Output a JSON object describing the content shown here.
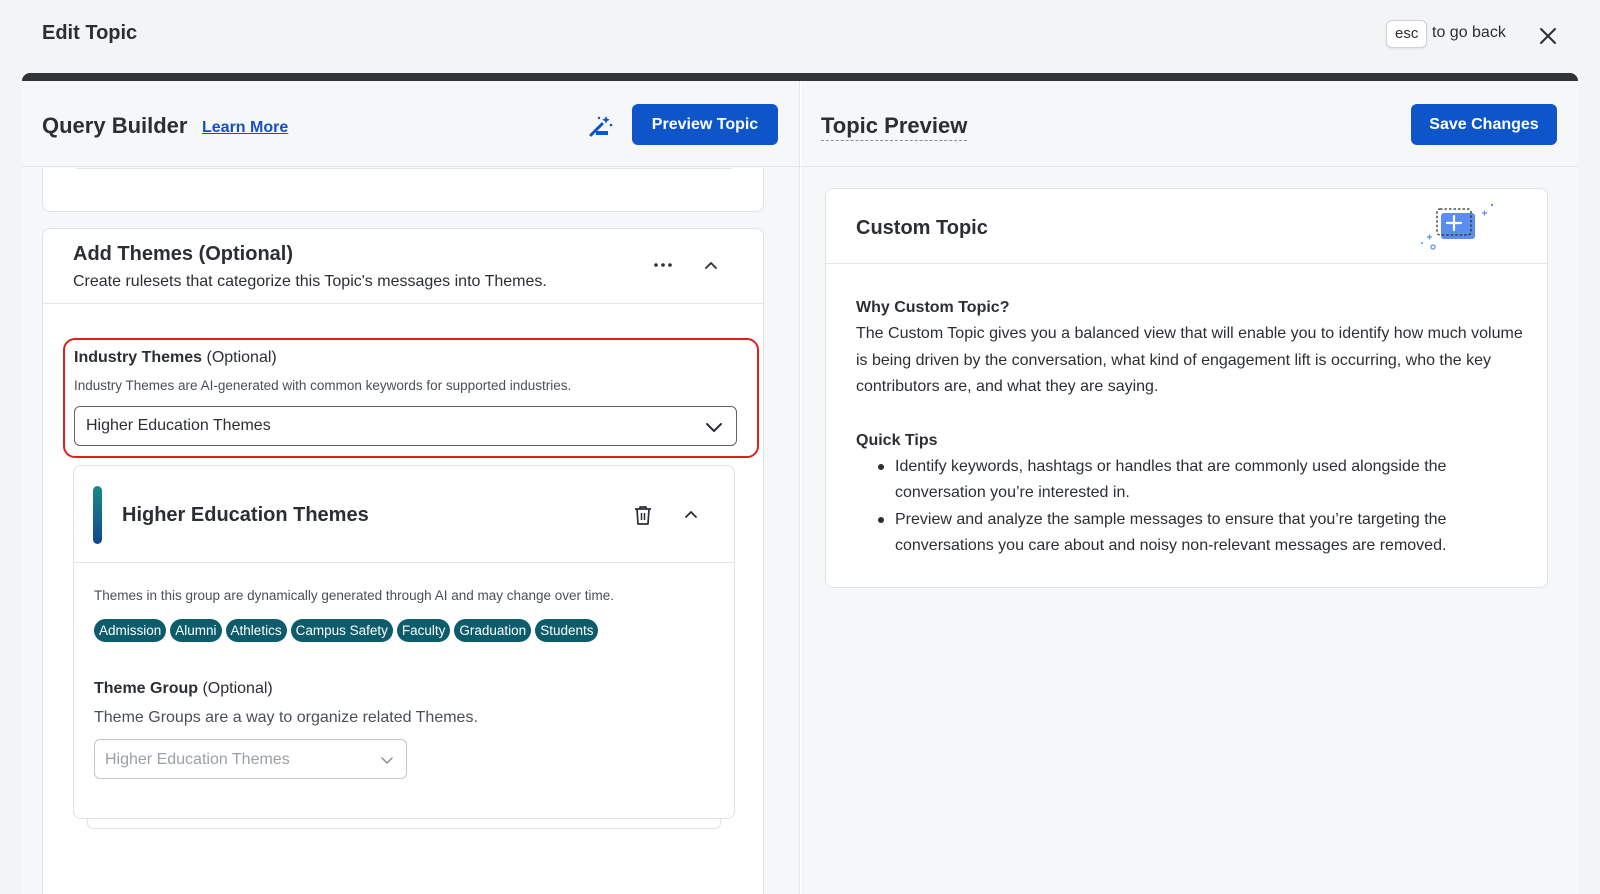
{
  "topbar": {
    "title": "Edit Topic",
    "esc_key": "esc",
    "esc_text": "to go back",
    "close_icon": "close-icon"
  },
  "query_builder": {
    "title": "Query Builder",
    "learn_more": "Learn More",
    "wand_icon": "magic-wand-icon",
    "preview_button": "Preview Topic",
    "themes": {
      "title": "Add Themes (Optional)",
      "subtitle": "Create rulesets that categorize this Topic's messages into Themes.",
      "industry": {
        "label": "Industry Themes",
        "optional": "(Optional)",
        "help": "Industry Themes are AI-generated with common keywords for supported industries.",
        "selected": "Higher Education Themes"
      },
      "group_card": {
        "title": "Higher Education Themes",
        "description": "Themes in this group are dynamically generated through AI and may change over time.",
        "chips": [
          "Admission",
          "Alumni",
          "Athletics",
          "Campus Safety",
          "Faculty",
          "Graduation",
          "Students"
        ],
        "theme_group": {
          "label": "Theme Group",
          "optional": "(Optional)",
          "help": "Theme Groups are a way to organize related Themes.",
          "placeholder": "Higher Education Themes"
        }
      }
    }
  },
  "topic_preview": {
    "title": "Topic Preview",
    "save_button": "Save Changes",
    "card": {
      "title": "Custom Topic",
      "why_heading": "Why Custom Topic?",
      "why_text": "The Custom Topic gives you a balanced view that will enable you to identify how much volume is being driven by the conversation, what kind of engagement lift is occurring, who the key contributors are, and what they are saying.",
      "tips_heading": "Quick Tips",
      "tips": [
        "Identify keywords, hashtags or handles that are commonly used alongside the conversation you’re interested in.",
        "Preview and analyze the sample messages to ensure that you’re targeting the conversations you care about and noisy non-relevant messages are removed."
      ]
    }
  },
  "colors": {
    "primary": "#0d55c9",
    "chip": "#0c5c6b",
    "highlight": "#e01e1e"
  }
}
